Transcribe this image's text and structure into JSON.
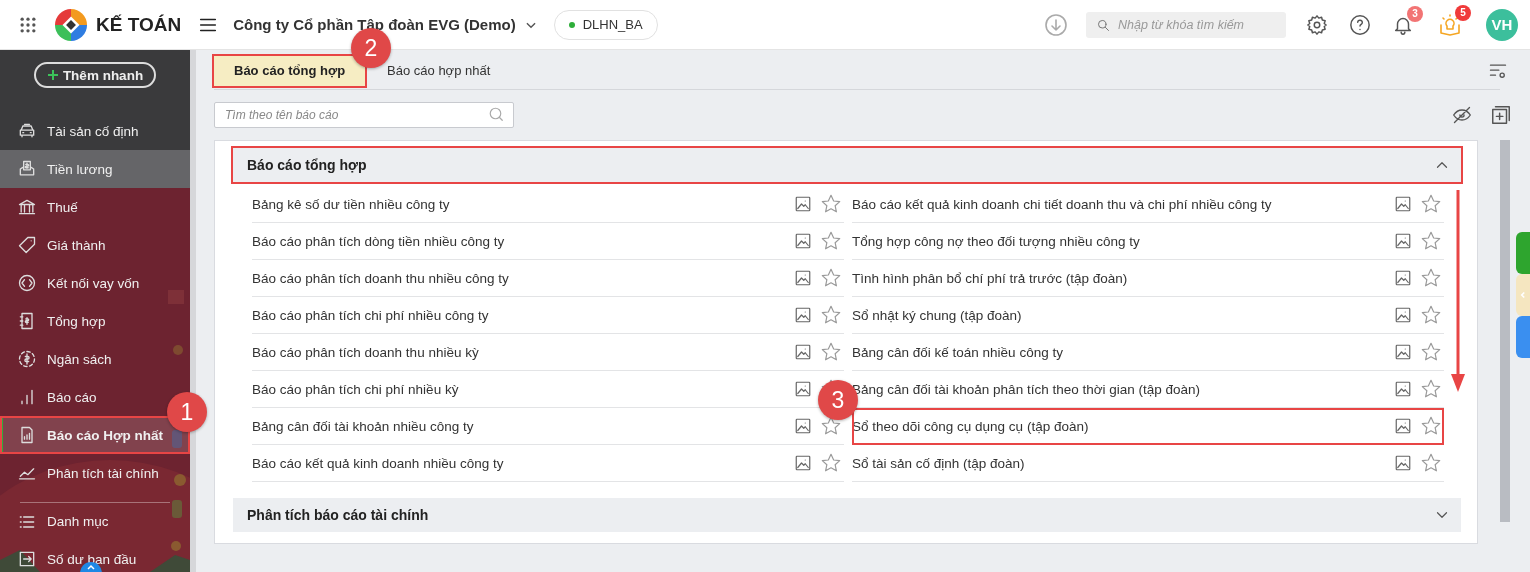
{
  "app": {
    "name": "KẾ TOÁN"
  },
  "company": {
    "name": "Công ty Cổ phần Tập đoàn EVG (Demo)"
  },
  "branch": {
    "name": "DLHN_BA"
  },
  "search": {
    "placeholder": "Nhập từ khóa tìm kiếm"
  },
  "notifications": {
    "count": "3"
  },
  "tips": {
    "count": "5"
  },
  "user": {
    "initials": "VH"
  },
  "sidebar": {
    "quick_add": "Thêm nhanh",
    "items": [
      {
        "label": "Tài sản cố định",
        "selected": false,
        "hovered": false,
        "annotated": false,
        "group_start": false
      },
      {
        "label": "Tiền lương",
        "selected": false,
        "hovered": true,
        "annotated": false,
        "group_start": false
      },
      {
        "label": "Thuế",
        "selected": false,
        "hovered": false,
        "annotated": false,
        "group_start": false
      },
      {
        "label": "Giá thành",
        "selected": false,
        "hovered": false,
        "annotated": false,
        "group_start": false
      },
      {
        "label": "Kết nối vay vốn",
        "selected": false,
        "hovered": false,
        "annotated": false,
        "group_start": false
      },
      {
        "label": "Tổng hợp",
        "selected": false,
        "hovered": false,
        "annotated": false,
        "group_start": false
      },
      {
        "label": "Ngân sách",
        "selected": false,
        "hovered": false,
        "annotated": false,
        "group_start": false
      },
      {
        "label": "Báo cáo",
        "selected": false,
        "hovered": false,
        "annotated": false,
        "group_start": false
      },
      {
        "label": "Báo cáo Hợp nhất",
        "selected": true,
        "hovered": false,
        "annotated": true,
        "group_start": false
      },
      {
        "label": "Phân tích tài chính",
        "selected": false,
        "hovered": false,
        "annotated": false,
        "group_start": false
      },
      {
        "label": "Danh mục",
        "selected": false,
        "hovered": false,
        "annotated": false,
        "group_start": true
      },
      {
        "label": "Số dư ban đầu",
        "selected": false,
        "hovered": false,
        "annotated": false,
        "group_start": false
      }
    ]
  },
  "tabs": [
    {
      "label": "Báo cáo tổng hợp",
      "selected": true,
      "annotated": true
    },
    {
      "label": "Báo cáo hợp nhất",
      "selected": false,
      "annotated": false
    }
  ],
  "report_search": {
    "placeholder": "Tìm theo tên báo cáo"
  },
  "groups": [
    {
      "title": "Báo cáo tổng hợp",
      "expanded": true,
      "annotated": true,
      "items": [
        {
          "label": "Bảng kê số dư tiền nhiều công ty",
          "favorite": false,
          "annotated": false
        },
        {
          "label": "Báo cáo kết quả kinh doanh chi tiết doanh thu và chi phí nhiều công ty",
          "favorite": false,
          "annotated": false
        },
        {
          "label": "Báo cáo phân tích dòng tiền nhiều công ty",
          "favorite": false,
          "annotated": false
        },
        {
          "label": "Tổng hợp công nợ theo đối tượng nhiều công ty",
          "favorite": false,
          "annotated": false
        },
        {
          "label": "Báo cáo phân tích doanh thu nhiều công ty",
          "favorite": false,
          "annotated": false
        },
        {
          "label": "Tình hình phân bổ chí phí trả trước (tập đoàn)",
          "favorite": false,
          "annotated": false
        },
        {
          "label": "Báo cáo phân tích chi phí nhiều công ty",
          "favorite": false,
          "annotated": false
        },
        {
          "label": "Sổ nhật ký chung (tập đoàn)",
          "favorite": false,
          "annotated": false
        },
        {
          "label": "Báo cáo phân tích doanh thu nhiều kỳ",
          "favorite": false,
          "annotated": false
        },
        {
          "label": "Bảng cân đối kế toán nhiều công ty",
          "favorite": false,
          "annotated": false
        },
        {
          "label": "Báo cáo phân tích chi phí nhiều kỳ",
          "favorite": false,
          "annotated": false
        },
        {
          "label": "Bảng cân đối tài khoản phân tích theo thời gian (tập đoàn)",
          "favorite": false,
          "annotated": false
        },
        {
          "label": "Bảng cân đối tài khoản nhiều công ty",
          "favorite": false,
          "annotated": false
        },
        {
          "label": "Sổ theo dõi công cụ dụng cụ (tập đoàn)",
          "favorite": false,
          "annotated": true
        },
        {
          "label": "Báo cáo kết quả kinh doanh nhiều công ty",
          "favorite": false,
          "annotated": false
        },
        {
          "label": "Sổ tài sản cố định (tập đoàn)",
          "favorite": false,
          "annotated": false
        }
      ]
    },
    {
      "title": "Phân tích báo cáo tài chính",
      "expanded": false,
      "annotated": false
    }
  ],
  "callouts": [
    {
      "label": "1"
    },
    {
      "label": "2"
    },
    {
      "label": "3"
    }
  ]
}
